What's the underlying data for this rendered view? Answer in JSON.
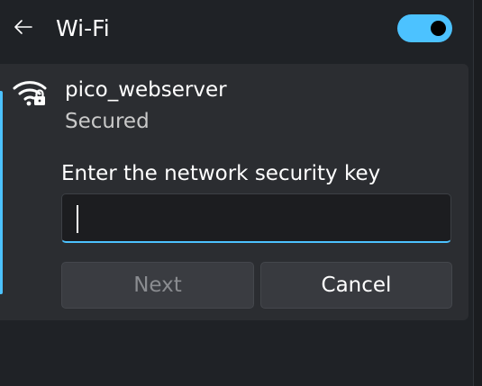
{
  "header": {
    "back_icon": "arrow-left-icon",
    "title": "Wi-Fi",
    "toggle_state": "on"
  },
  "network": {
    "icon": "wifi-secured-icon",
    "name": "pico_webserver",
    "status": "Secured"
  },
  "security_key": {
    "label": "Enter the network security key",
    "value": "",
    "placeholder": ""
  },
  "buttons": {
    "next_label": "Next",
    "next_enabled": false,
    "cancel_label": "Cancel"
  },
  "colors": {
    "accent": "#4cc2ff",
    "background": "#1f2226",
    "card": "#2b2d31",
    "text_primary": "#ffffff",
    "text_secondary": "#c9c9c9",
    "disabled_text": "#8a8c90"
  }
}
